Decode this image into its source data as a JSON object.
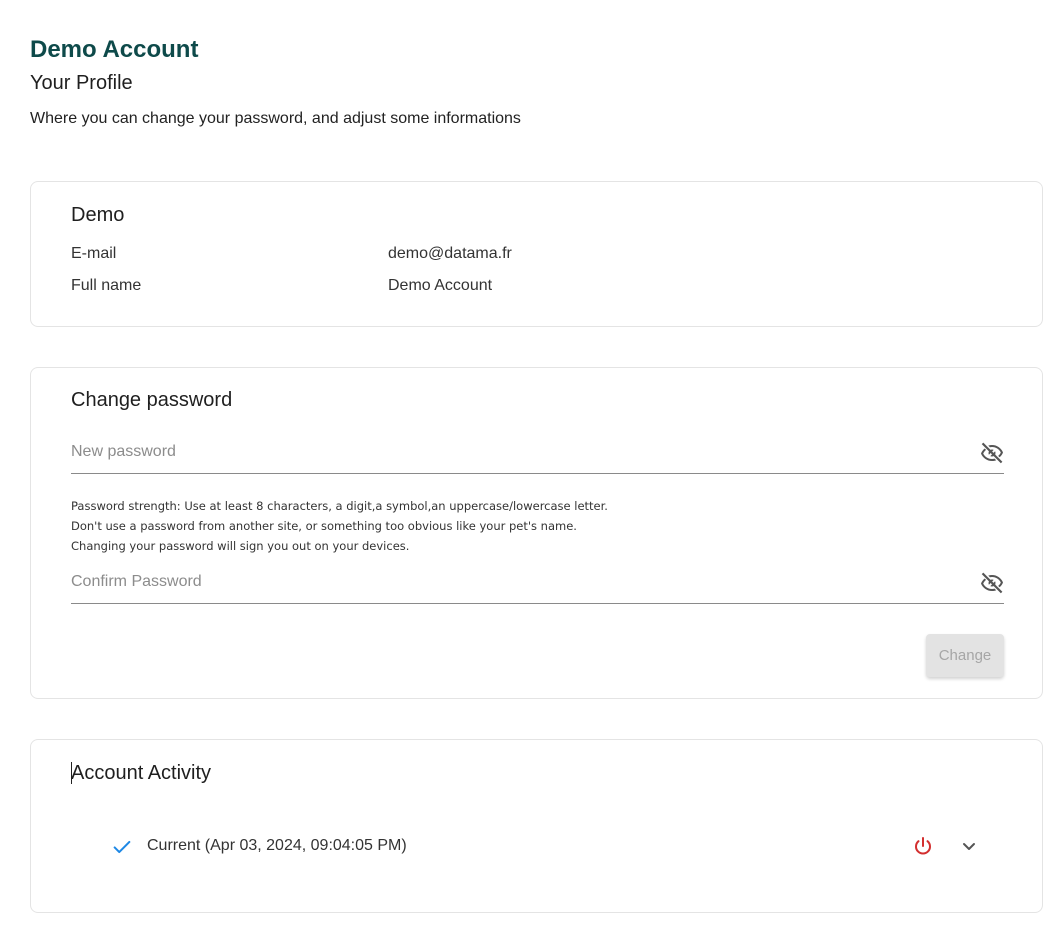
{
  "header": {
    "app_title": "Demo Account",
    "page_title": "Your Profile",
    "page_subtitle": "Where you can change your password, and adjust some informations"
  },
  "profile": {
    "title": "Demo",
    "email_label": "E-mail",
    "email_value": "demo@datama.fr",
    "fullname_label": "Full name",
    "fullname_value": "Demo Account"
  },
  "password": {
    "title": "Change password",
    "new_placeholder": "New password",
    "confirm_placeholder": "Confirm Password",
    "hint_lines": [
      "Password strength: Use at least 8 characters, a digit,a symbol,an uppercase/lowercase letter.",
      "Don't use a password from another site, or something too obvious like your pet's name.",
      "Changing your password will sign you out on your devices."
    ],
    "change_label": "Change"
  },
  "activity": {
    "title": "Account Activity",
    "sessions": [
      {
        "label": "Current (Apr 03, 2024, 09:04:05 PM)"
      }
    ]
  },
  "colors": {
    "brand": "#0e4a4a",
    "check": "#1e88e5",
    "power": "#d32f2f",
    "icon_grey": "#555555"
  },
  "icons": {
    "eye": "eye-off-icon",
    "check": "check-icon",
    "power": "power-icon",
    "chevron": "chevron-down-icon"
  }
}
